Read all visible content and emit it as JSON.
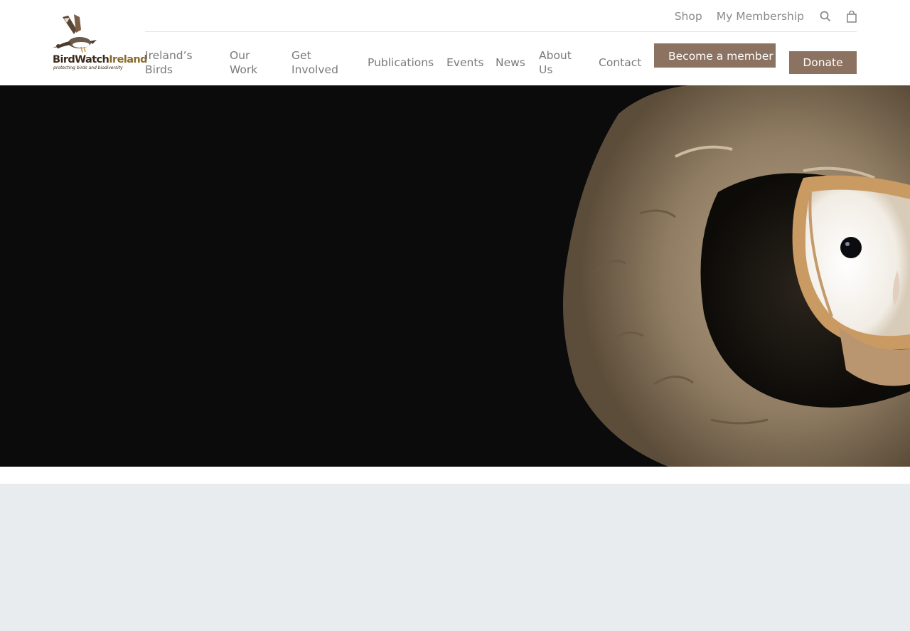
{
  "brand": {
    "name_part1": "BirdWatch",
    "name_part2": "Ireland",
    "tagline": "protecting birds and biodiversity",
    "accent_color": "#8c7260"
  },
  "topbar": {
    "shop": "Shop",
    "membership": "My Membership",
    "search_icon": "search-icon",
    "cart_icon": "shopping-bag-icon"
  },
  "nav": {
    "items": [
      {
        "line1": "Ireland’s",
        "line2": "Birds"
      },
      {
        "line1": "Our",
        "line2": "Work"
      },
      {
        "line1": "Get",
        "line2": "Involved"
      },
      {
        "line1": "Publications",
        "line2": ""
      },
      {
        "line1": "Events",
        "line2": ""
      },
      {
        "line1": "News",
        "line2": ""
      },
      {
        "line1": "About",
        "line2": "Us"
      },
      {
        "line1": "Contact",
        "line2": ""
      }
    ],
    "become_member": "Become a member",
    "donate": "Donate"
  },
  "hero": {
    "image": "barn-owl-in-tree-hollow"
  }
}
